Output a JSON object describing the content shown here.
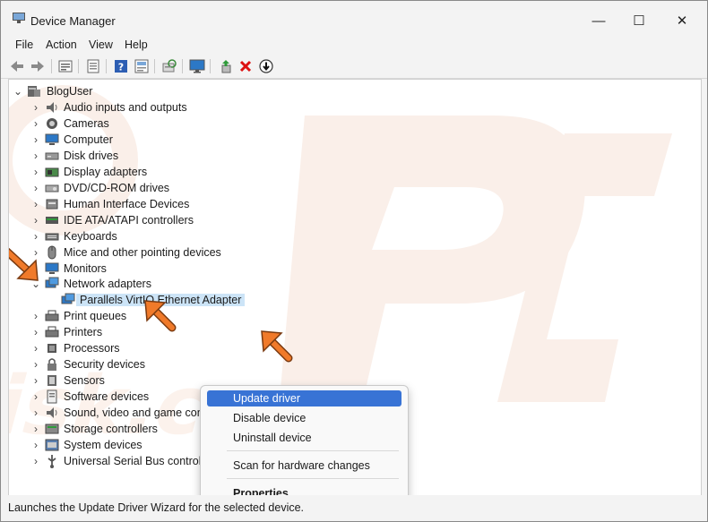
{
  "window": {
    "title": "Device Manager",
    "controls": {
      "minimize": "—",
      "maximize": "☐",
      "close": "✕"
    }
  },
  "menu": [
    "File",
    "Action",
    "View",
    "Help"
  ],
  "toolbar": [
    "back-icon",
    "forward-icon",
    "properties-icon",
    "driver-details-icon",
    "help-icon",
    "show-hidden-icon",
    "scan-hardware-icon",
    "monitor-icon",
    "update-driver-icon",
    "uninstall-icon",
    "disable-icon"
  ],
  "tree": {
    "root": "BlogUser",
    "categories": [
      {
        "label": "Audio inputs and outputs",
        "icon": "speaker-icon"
      },
      {
        "label": "Cameras",
        "icon": "camera-icon"
      },
      {
        "label": "Computer",
        "icon": "computer-icon"
      },
      {
        "label": "Disk drives",
        "icon": "disk-icon"
      },
      {
        "label": "Display adapters",
        "icon": "display-adapter-icon"
      },
      {
        "label": "DVD/CD-ROM drives",
        "icon": "dvd-icon"
      },
      {
        "label": "Human Interface Devices",
        "icon": "hid-icon"
      },
      {
        "label": "IDE ATA/ATAPI controllers",
        "icon": "ide-icon"
      },
      {
        "label": "Keyboards",
        "icon": "keyboard-icon"
      },
      {
        "label": "Mice and other pointing devices",
        "icon": "mouse-icon"
      },
      {
        "label": "Monitors",
        "icon": "monitor-icon"
      },
      {
        "label": "Network adapters",
        "icon": "network-icon",
        "expanded": true
      },
      {
        "label": "Parallels VirtIO Ethernet Adapter",
        "icon": "network-icon",
        "child": true,
        "selected": true
      },
      {
        "label": "Print queues",
        "icon": "printer-icon"
      },
      {
        "label": "Printers",
        "icon": "printer-icon"
      },
      {
        "label": "Processors",
        "icon": "processor-icon"
      },
      {
        "label": "Security devices",
        "icon": "security-icon"
      },
      {
        "label": "Sensors",
        "icon": "sensor-icon"
      },
      {
        "label": "Software devices",
        "icon": "software-icon"
      },
      {
        "label": "Sound, video and game controllers",
        "icon": "speaker-icon"
      },
      {
        "label": "Storage controllers",
        "icon": "storage-icon"
      },
      {
        "label": "System devices",
        "icon": "system-icon"
      },
      {
        "label": "Universal Serial Bus controllers",
        "icon": "usb-icon"
      }
    ]
  },
  "context_menu": {
    "items": [
      "Update driver",
      "Disable device",
      "Uninstall device",
      "Scan for hardware changes",
      "Properties"
    ],
    "highlighted": "Update driver"
  },
  "status_bar": "Launches the Update Driver Wizard for the selected device.",
  "colors": {
    "accent": "#3873d5",
    "selection": "#cce4f7",
    "arrow": "#f07a2a",
    "watermark": "#f6e7df"
  }
}
